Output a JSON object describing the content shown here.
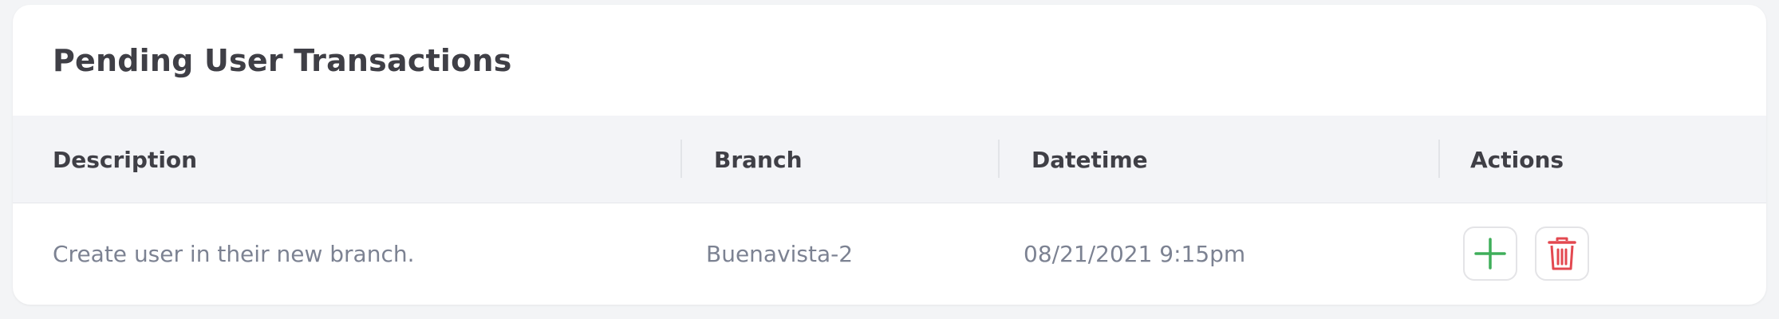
{
  "card": {
    "title": "Pending User Transactions"
  },
  "table": {
    "columns": [
      "Description",
      "Branch",
      "Datetime",
      "Actions"
    ],
    "rows": [
      {
        "description": "Create user in their new branch.",
        "branch": "Buenavista-2",
        "datetime": "08/21/2021 9:15pm",
        "actions": [
          {
            "name": "approve",
            "icon": "plus-icon",
            "color": "#3fae5a"
          },
          {
            "name": "delete",
            "icon": "trash-icon",
            "color": "#e34850"
          }
        ]
      }
    ]
  },
  "colors": {
    "background": "#f3f4f6",
    "card": "#ffffff",
    "header_bg": "#f3f4f7",
    "title_text": "#3f3f46",
    "cell_text": "#7c8292",
    "approve": "#3fae5a",
    "delete": "#e34850"
  }
}
